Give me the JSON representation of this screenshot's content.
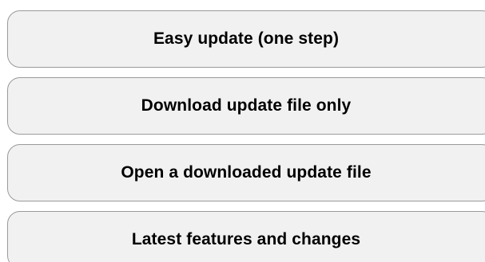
{
  "buttons": [
    {
      "label": "Easy update (one step)"
    },
    {
      "label": "Download update file only"
    },
    {
      "label": "Open a downloaded update file"
    },
    {
      "label": "Latest features and changes"
    }
  ],
  "colors": {
    "button_background": "#f1f1f1",
    "button_border": "#9a9a9a",
    "text": "#000000",
    "page_background": "#ffffff"
  }
}
